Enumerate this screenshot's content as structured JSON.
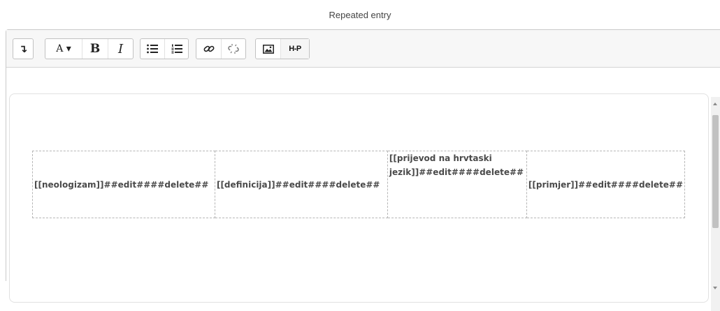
{
  "field_title": "Repeated entry",
  "toolbar": {
    "groups": [
      {
        "name": "expand",
        "buttons": [
          {
            "icon": "expand-icon",
            "glyph": "↴"
          }
        ]
      },
      {
        "name": "formatting",
        "buttons": [
          {
            "icon": "paragraph-style-icon",
            "glyph": "A ▾"
          },
          {
            "icon": "bold-icon",
            "glyph": "B"
          },
          {
            "icon": "italic-icon",
            "glyph": "I"
          }
        ]
      },
      {
        "name": "lists",
        "buttons": [
          {
            "icon": "unordered-list-icon"
          },
          {
            "icon": "ordered-list-icon"
          }
        ]
      },
      {
        "name": "links",
        "buttons": [
          {
            "icon": "link-icon"
          },
          {
            "icon": "unlink-icon"
          }
        ]
      },
      {
        "name": "media",
        "buttons": [
          {
            "icon": "image-icon"
          },
          {
            "icon": "h5p-icon",
            "glyph": "H-P"
          }
        ]
      }
    ]
  },
  "table": {
    "cells": [
      "[[neologizam]]##edit####delete##",
      "[[definicija]]##edit####delete##",
      "[[prijevod na hrvtaski jezik]]##edit####delete##",
      "[[primjer]]##edit####delete##"
    ]
  },
  "colors": {
    "toolbar_bg": "#f7f7f7",
    "border": "#c9c9c9",
    "cell_border": "#b6b6b6",
    "text": "#4a4a4a"
  }
}
